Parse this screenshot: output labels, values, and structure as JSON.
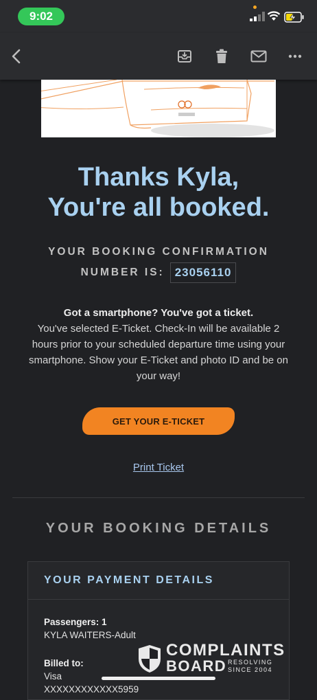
{
  "status_bar": {
    "time": "9:02"
  },
  "email": {
    "headline_line1": "Thanks Kyla,",
    "headline_line2": "You're all booked.",
    "confirmation_label_1": "YOUR BOOKING CONFIRMATION",
    "confirmation_label_2": "NUMBER IS:",
    "confirmation_number": "23056110",
    "info_bold": "Got a smartphone? You've got a ticket.",
    "info_text": "You've selected E-Ticket. Check-In will be available 2 hours prior to your scheduled departure time using your smartphone. Show your E-Ticket and photo ID and be on your way!",
    "cta_label": "GET YOUR E-TICKET",
    "print_link": "Print Ticket",
    "details_heading": "YOUR BOOKING DETAILS",
    "payment": {
      "heading": "YOUR PAYMENT DETAILS",
      "passengers_label": "Passengers: 1",
      "passenger_name": "KYLA WAITERS-Adult",
      "billed_label": "Billed to:",
      "billed_method": "Visa",
      "card_masked": "XXXXXXXXXXXX5959"
    }
  },
  "watermark": {
    "line1": "COMPLAINTS",
    "line2": "BOARD",
    "tagline_1": "RESOLVING",
    "tagline_2": "SINCE 2004"
  },
  "colors": {
    "background": "#202124",
    "accent_blue": "#a9d1f0",
    "cta_orange": "#f28422",
    "status_green": "#34c759"
  },
  "icons": [
    "back-arrow-icon",
    "archive-icon",
    "trash-icon",
    "mail-icon",
    "more-icon"
  ]
}
